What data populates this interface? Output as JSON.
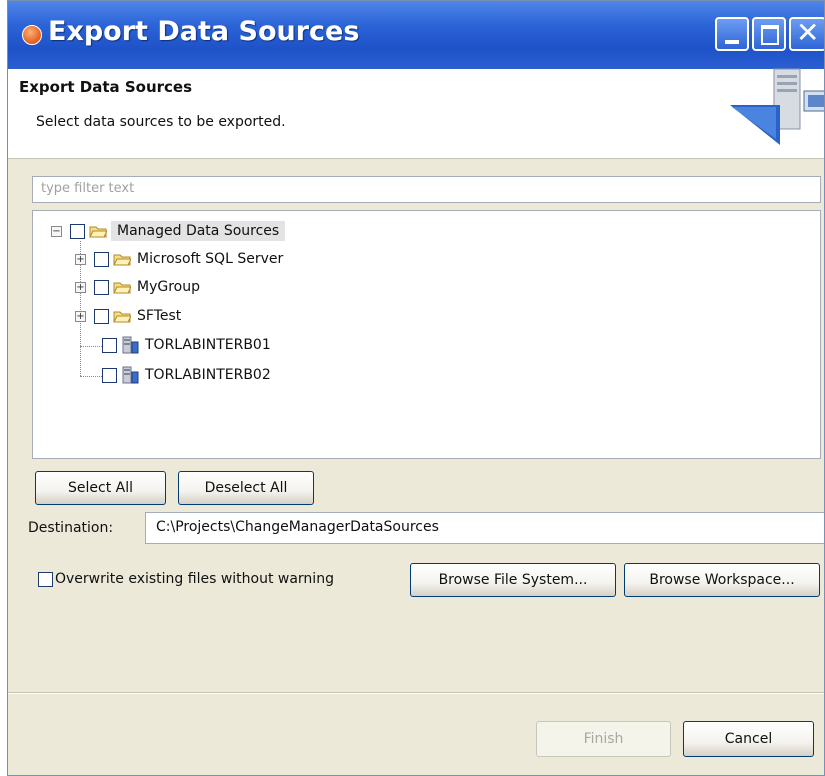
{
  "window": {
    "title": "Export Data Sources"
  },
  "header": {
    "title": "Export Data Sources",
    "description": "Select data sources to be exported."
  },
  "filter": {
    "placeholder": "type filter text",
    "value": ""
  },
  "tree": {
    "root": {
      "label": "Managed Data Sources",
      "expanded": true,
      "checked": false
    },
    "children": [
      {
        "label": "Microsoft SQL Server",
        "type": "folder",
        "expandable": true,
        "checked": false
      },
      {
        "label": "MyGroup",
        "type": "folder",
        "expandable": true,
        "checked": false
      },
      {
        "label": "SFTest",
        "type": "folder",
        "expandable": true,
        "checked": false
      },
      {
        "label": "TORLABINTERB01",
        "type": "server",
        "expandable": false,
        "checked": false
      },
      {
        "label": "TORLABINTERB02",
        "type": "server",
        "expandable": false,
        "checked": false
      }
    ]
  },
  "buttons": {
    "select_all": "Select All",
    "deselect_all": "Deselect All",
    "browse_file_system": "Browse File System...",
    "browse_workspace": "Browse Workspace...",
    "finish": "Finish",
    "cancel": "Cancel"
  },
  "destination": {
    "label": "Destination:",
    "value": "C:\\Projects\\ChangeManagerDataSources"
  },
  "overwrite": {
    "label": "Overwrite existing files without warning",
    "checked": false
  },
  "icons": {
    "app": "eclipse-app-icon",
    "minimize": "minimize-icon",
    "maximize": "maximize-icon",
    "close": "close-icon",
    "wizard_banner": "export-server-icon",
    "folder": "folder-icon",
    "server": "server-icon"
  },
  "colors": {
    "titlebar": "#2c64d8",
    "dialog_bg": "#ece9d8",
    "button_border": "#003c74"
  },
  "state": {
    "finish_enabled": false
  }
}
